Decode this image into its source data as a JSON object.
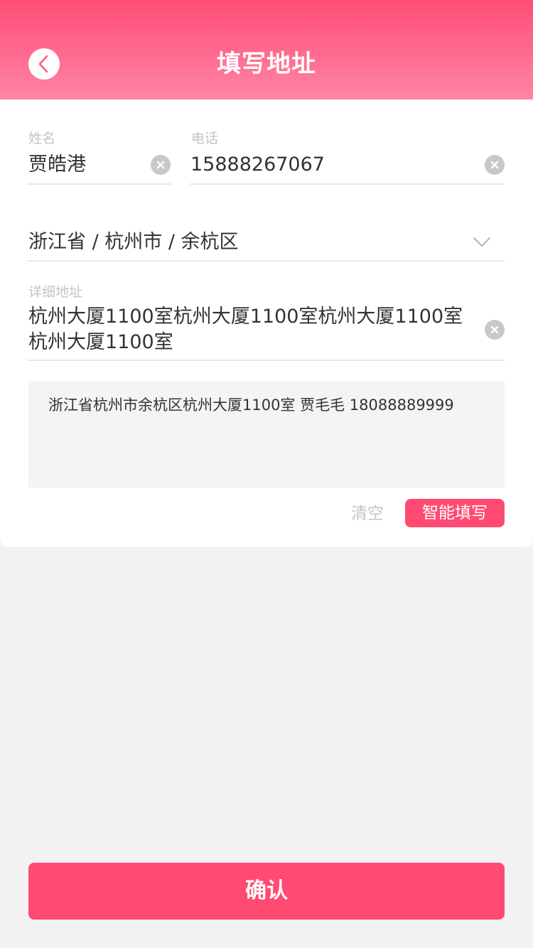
{
  "header": {
    "title": "填写地址",
    "back_icon": "back-arrow-icon"
  },
  "form": {
    "name": {
      "label": "姓名",
      "value": "贾皓港"
    },
    "phone": {
      "label": "电话",
      "value": "15888267067"
    },
    "region": {
      "value": "浙江省 / 杭州市 / 余杭区",
      "icon": "chevron-down-icon"
    },
    "detail": {
      "label": "详细地址",
      "value": "杭州大厦1100室杭州大厦1100室杭州大厦1100室杭州大厦1100室"
    },
    "clear_icon": "clear-circle-icon"
  },
  "smart_paste": {
    "text": "浙江省杭州市余杭区杭州大厦1100室 贾毛毛 18088889999",
    "clear_label": "清空",
    "fill_label": "智能填写"
  },
  "footer": {
    "confirm_label": "确认"
  },
  "colors": {
    "accent": "#ff4a72",
    "header_gradient_top": "#ff4d76",
    "header_gradient_bottom": "#ff85a5",
    "background": "#f2f2f2"
  }
}
